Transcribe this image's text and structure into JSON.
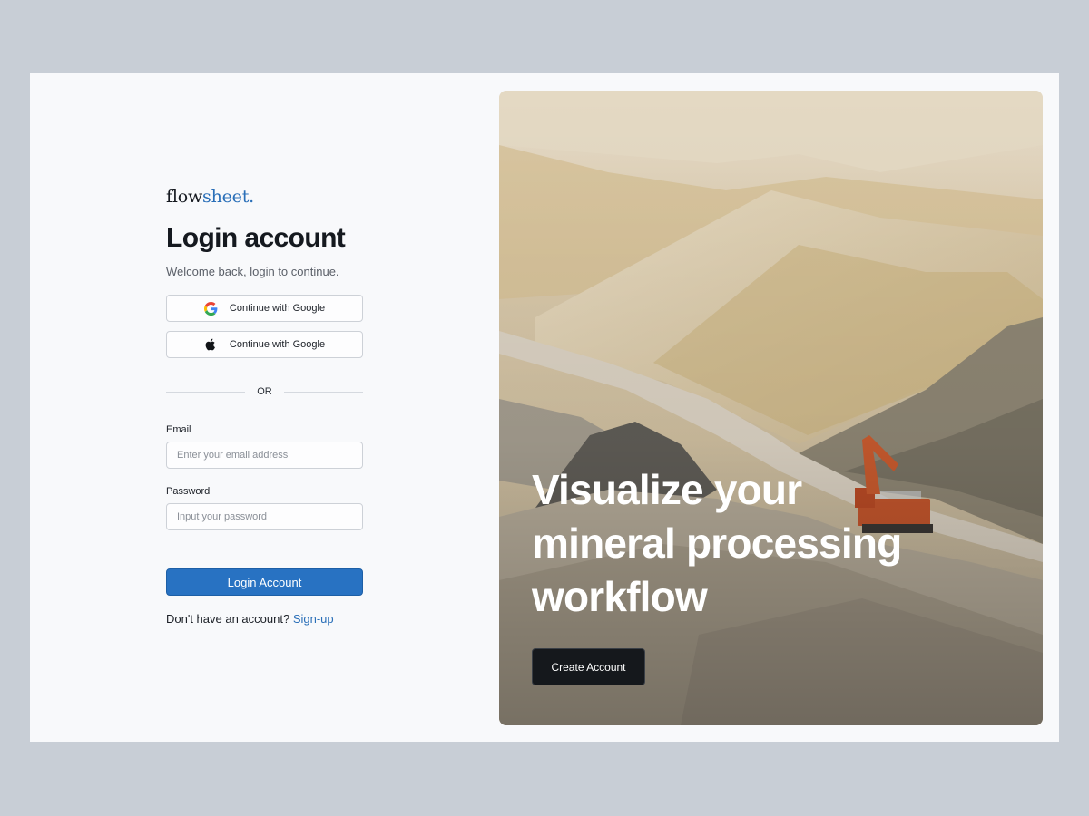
{
  "brand": {
    "name_main": "flow",
    "name_accent": "sheet.",
    "accent_color": "#2a6fb8"
  },
  "login": {
    "title": "Login account",
    "subtitle": "Welcome back, login to continue.",
    "google_button_label": "Continue with Google",
    "apple_button_label": "Continue with Google",
    "divider_text": "OR",
    "email_label": "Email",
    "email_placeholder": "Enter your email address",
    "password_label": "Password",
    "password_placeholder": "Input your password",
    "submit_label": "Login Account",
    "signup_prompt": "Don't have an account?",
    "signup_link": "Sign-up"
  },
  "hero": {
    "headline_line1": "Visualize your",
    "headline_line2": "mineral processing",
    "headline_line3": "workflow",
    "cta_label": "Create Account",
    "image_subject": "quarry-with-excavator"
  },
  "colors": {
    "page_background": "#c8ced6",
    "card_background": "#f8f9fb",
    "primary": "#2872c2",
    "cta_dark": "#15181c"
  },
  "icons": {
    "google": "google-icon",
    "apple": "apple-icon"
  }
}
